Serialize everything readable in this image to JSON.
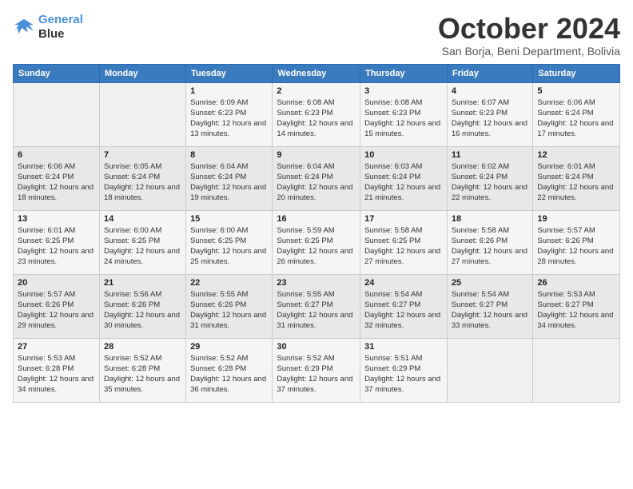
{
  "logo": {
    "line1": "General",
    "line2": "Blue"
  },
  "title": "October 2024",
  "subtitle": "San Borja, Beni Department, Bolivia",
  "days_header": [
    "Sunday",
    "Monday",
    "Tuesday",
    "Wednesday",
    "Thursday",
    "Friday",
    "Saturday"
  ],
  "weeks": [
    [
      {
        "day": "",
        "info": ""
      },
      {
        "day": "",
        "info": ""
      },
      {
        "day": "1",
        "info": "Sunrise: 6:09 AM\nSunset: 6:23 PM\nDaylight: 12 hours and 13 minutes."
      },
      {
        "day": "2",
        "info": "Sunrise: 6:08 AM\nSunset: 6:23 PM\nDaylight: 12 hours and 14 minutes."
      },
      {
        "day": "3",
        "info": "Sunrise: 6:08 AM\nSunset: 6:23 PM\nDaylight: 12 hours and 15 minutes."
      },
      {
        "day": "4",
        "info": "Sunrise: 6:07 AM\nSunset: 6:23 PM\nDaylight: 12 hours and 16 minutes."
      },
      {
        "day": "5",
        "info": "Sunrise: 6:06 AM\nSunset: 6:24 PM\nDaylight: 12 hours and 17 minutes."
      }
    ],
    [
      {
        "day": "6",
        "info": "Sunrise: 6:06 AM\nSunset: 6:24 PM\nDaylight: 12 hours and 18 minutes."
      },
      {
        "day": "7",
        "info": "Sunrise: 6:05 AM\nSunset: 6:24 PM\nDaylight: 12 hours and 18 minutes."
      },
      {
        "day": "8",
        "info": "Sunrise: 6:04 AM\nSunset: 6:24 PM\nDaylight: 12 hours and 19 minutes."
      },
      {
        "day": "9",
        "info": "Sunrise: 6:04 AM\nSunset: 6:24 PM\nDaylight: 12 hours and 20 minutes."
      },
      {
        "day": "10",
        "info": "Sunrise: 6:03 AM\nSunset: 6:24 PM\nDaylight: 12 hours and 21 minutes."
      },
      {
        "day": "11",
        "info": "Sunrise: 6:02 AM\nSunset: 6:24 PM\nDaylight: 12 hours and 22 minutes."
      },
      {
        "day": "12",
        "info": "Sunrise: 6:01 AM\nSunset: 6:24 PM\nDaylight: 12 hours and 22 minutes."
      }
    ],
    [
      {
        "day": "13",
        "info": "Sunrise: 6:01 AM\nSunset: 6:25 PM\nDaylight: 12 hours and 23 minutes."
      },
      {
        "day": "14",
        "info": "Sunrise: 6:00 AM\nSunset: 6:25 PM\nDaylight: 12 hours and 24 minutes."
      },
      {
        "day": "15",
        "info": "Sunrise: 6:00 AM\nSunset: 6:25 PM\nDaylight: 12 hours and 25 minutes."
      },
      {
        "day": "16",
        "info": "Sunrise: 5:59 AM\nSunset: 6:25 PM\nDaylight: 12 hours and 26 minutes."
      },
      {
        "day": "17",
        "info": "Sunrise: 5:58 AM\nSunset: 6:25 PM\nDaylight: 12 hours and 27 minutes."
      },
      {
        "day": "18",
        "info": "Sunrise: 5:58 AM\nSunset: 6:26 PM\nDaylight: 12 hours and 27 minutes."
      },
      {
        "day": "19",
        "info": "Sunrise: 5:57 AM\nSunset: 6:26 PM\nDaylight: 12 hours and 28 minutes."
      }
    ],
    [
      {
        "day": "20",
        "info": "Sunrise: 5:57 AM\nSunset: 6:26 PM\nDaylight: 12 hours and 29 minutes."
      },
      {
        "day": "21",
        "info": "Sunrise: 5:56 AM\nSunset: 6:26 PM\nDaylight: 12 hours and 30 minutes."
      },
      {
        "day": "22",
        "info": "Sunrise: 5:55 AM\nSunset: 6:26 PM\nDaylight: 12 hours and 31 minutes."
      },
      {
        "day": "23",
        "info": "Sunrise: 5:55 AM\nSunset: 6:27 PM\nDaylight: 12 hours and 31 minutes."
      },
      {
        "day": "24",
        "info": "Sunrise: 5:54 AM\nSunset: 6:27 PM\nDaylight: 12 hours and 32 minutes."
      },
      {
        "day": "25",
        "info": "Sunrise: 5:54 AM\nSunset: 6:27 PM\nDaylight: 12 hours and 33 minutes."
      },
      {
        "day": "26",
        "info": "Sunrise: 5:53 AM\nSunset: 6:27 PM\nDaylight: 12 hours and 34 minutes."
      }
    ],
    [
      {
        "day": "27",
        "info": "Sunrise: 5:53 AM\nSunset: 6:28 PM\nDaylight: 12 hours and 34 minutes."
      },
      {
        "day": "28",
        "info": "Sunrise: 5:52 AM\nSunset: 6:28 PM\nDaylight: 12 hours and 35 minutes."
      },
      {
        "day": "29",
        "info": "Sunrise: 5:52 AM\nSunset: 6:28 PM\nDaylight: 12 hours and 36 minutes."
      },
      {
        "day": "30",
        "info": "Sunrise: 5:52 AM\nSunset: 6:29 PM\nDaylight: 12 hours and 37 minutes."
      },
      {
        "day": "31",
        "info": "Sunrise: 5:51 AM\nSunset: 6:29 PM\nDaylight: 12 hours and 37 minutes."
      },
      {
        "day": "",
        "info": ""
      },
      {
        "day": "",
        "info": ""
      }
    ]
  ]
}
